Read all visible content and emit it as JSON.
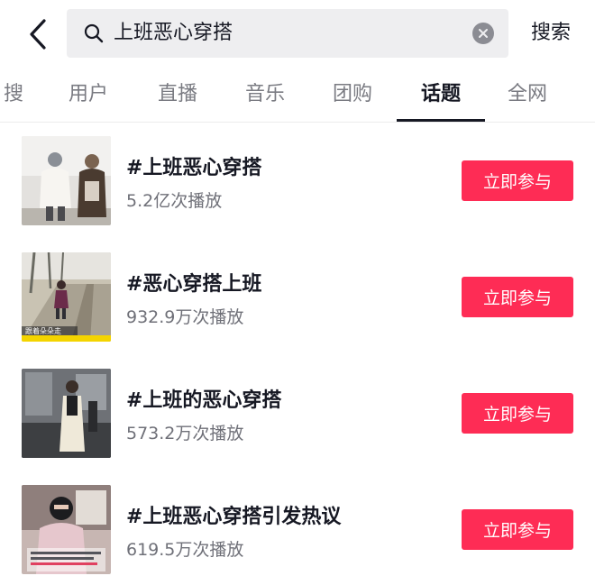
{
  "search": {
    "query": "上班恶心穿搭",
    "button_label": "搜索"
  },
  "tabs": [
    {
      "label": "搜",
      "active": false
    },
    {
      "label": "用户",
      "active": false
    },
    {
      "label": "直播",
      "active": false
    },
    {
      "label": "音乐",
      "active": false
    },
    {
      "label": "团购",
      "active": false
    },
    {
      "label": "话题",
      "active": true
    },
    {
      "label": "全网",
      "active": false
    }
  ],
  "topics": [
    {
      "title": "#上班恶心穿搭",
      "views": "5.2亿次播放",
      "action": "立即参与"
    },
    {
      "title": "#恶心穿搭上班",
      "views": "932.9万次播放",
      "action": "立即参与"
    },
    {
      "title": "#上班的恶心穿搭",
      "views": "573.2万次播放",
      "action": "立即参与"
    },
    {
      "title": "#上班恶心穿搭引发热议",
      "views": "619.5万次播放",
      "action": "立即参与"
    }
  ],
  "thumb_captions": {
    "item2": "跟着朵朵走"
  },
  "colors": {
    "accent": "#fe2c55",
    "search_bg": "#eeeef0",
    "text_primary": "#161823",
    "text_secondary": "#6f7078"
  },
  "icons": {
    "back": "chevron-left-icon",
    "search": "search-icon",
    "clear": "clear-icon"
  }
}
